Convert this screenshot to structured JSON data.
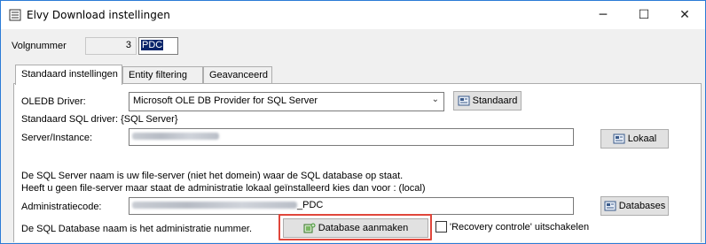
{
  "window": {
    "title": "Elvy Download instellingen",
    "controls": {
      "minimize": "─",
      "maximize": "☐",
      "close": "✕"
    }
  },
  "header": {
    "volgnummer_label": "Volgnummer",
    "volgnummer_value": "3",
    "suffix_value": "PDC"
  },
  "tabs": [
    {
      "label": "Standaard instellingen",
      "active": true
    },
    {
      "label": "Entity filtering",
      "active": false
    },
    {
      "label": "Geavanceerd",
      "active": false
    }
  ],
  "panel": {
    "oledb_label": "OLEDB Driver:",
    "oledb_value": "Microsoft OLE DB Provider for SQL Server",
    "standaard_button": "Standaard",
    "sql_driver_text": "Standaard SQL driver: {SQL Server}",
    "server_label": "Server/Instance:",
    "lokaal_button": "Lokaal",
    "info_line1": "De SQL Server naam is uw  file-server (niet het domein) waar de SQL database op staat.",
    "info_line2": "Heeft u geen file-server maar staat de administratie lokaal geïnstalleerd kies dan voor : (local)",
    "admincode_label": "Administratiecode:",
    "admincode_suffix": "_PDC",
    "databases_button": "Databases",
    "db_info_text": "De SQL Database naam is het administratie nummer.",
    "create_db_button": "Database aanmaken",
    "recovery_checkbox_label": "'Recovery controle' uitschakelen"
  },
  "colors": {
    "accent": "#2b7bd6",
    "highlight_border": "#e0463b",
    "selection": "#0a246a"
  }
}
